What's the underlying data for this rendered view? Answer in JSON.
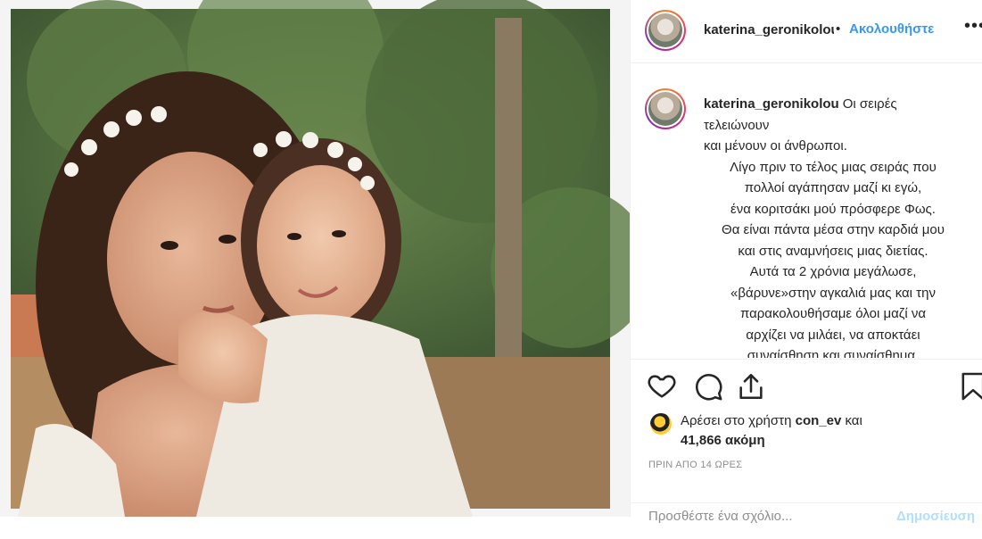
{
  "post": {
    "username": "katerina_geronikolou",
    "follow_label": "Ακολουθήστε",
    "dot": "•",
    "more_label": "•••",
    "colors": {
      "accent": "#3897f0",
      "text": "#262626",
      "muted": "#8e8e8e",
      "border": "#efefef"
    }
  },
  "caption": {
    "username": "katerina_geronikolou",
    "first_line": "Οι σειρές",
    "lines": [
      "τελειώνουν",
      "και μένουν οι άνθρωποι.",
      "Λίγο πριν το τέλος μιας σειράς που",
      "πολλοί αγάπησαν μαζί κι εγώ,",
      "ένα κοριτσάκι μού πρόσφερε Φως.",
      "Θα είναι πάντα μέσα στην καρδιά μου",
      "και στις αναμνήσεις μιας διετίας.",
      "Αυτά τα 2 χρόνια μεγάλωσε,",
      "«βάρυνε»στην αγκαλιά μας και την",
      "παρακολουθήσαμε όλοι μαζί να",
      "αρχίζει να μιλάει, να αποκτάει",
      "συναίσθηση και συναίσθημα."
    ]
  },
  "actions": {
    "icons": [
      "heart-icon",
      "comment-icon",
      "share-icon",
      "bookmark-icon"
    ]
  },
  "likes": {
    "prefix": "Αρέσει στο χρήστη",
    "liker": "con_ev",
    "and": "και",
    "count": "41,866 ακόμη"
  },
  "timestamp": "ΠΡΙΝ ΑΠΟ 14 ΩΡΕΣ",
  "comment": {
    "placeholder": "Προσθέστε ένα σχόλιο...",
    "post_label": "Δημοσίευση"
  }
}
